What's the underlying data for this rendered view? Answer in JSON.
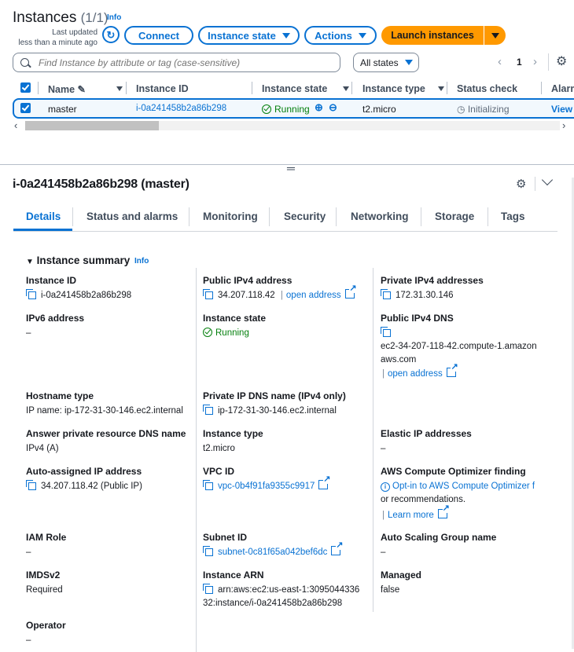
{
  "header": {
    "title": "Instances",
    "count": "(1/1)",
    "info": "Info",
    "last_updated_line1": "Last updated",
    "last_updated_line2": "less than a minute ago",
    "connect": "Connect",
    "instance_state": "Instance state",
    "actions": "Actions",
    "launch": "Launch instances"
  },
  "search": {
    "placeholder": "Find Instance by attribute or tag (case-sensitive)",
    "filter": "All states",
    "page": "1"
  },
  "table": {
    "columns": [
      "Name",
      "Instance ID",
      "Instance state",
      "Instance type",
      "Status check",
      "Alarm"
    ],
    "row": {
      "name": "master",
      "instance_id": "i-0a241458b2a86b298",
      "state": "Running",
      "type": "t2.micro",
      "status": "Initializing",
      "alarm": "View"
    }
  },
  "detail": {
    "title": "i-0a241458b2a86b298 (master)",
    "tabs": [
      "Details",
      "Status and alarms",
      "Monitoring",
      "Security",
      "Networking",
      "Storage",
      "Tags"
    ],
    "summary": "Instance summary",
    "info": "Info"
  },
  "fields": {
    "instance_id": {
      "label": "Instance ID",
      "value": "i-0a241458b2a86b298"
    },
    "public_ipv4": {
      "label": "Public IPv4 address",
      "value": "34.207.118.42",
      "link": "open address"
    },
    "private_ipv4": {
      "label": "Private IPv4 addresses",
      "value": "172.31.30.146"
    },
    "ipv6": {
      "label": "IPv6 address",
      "value": "–"
    },
    "instance_state": {
      "label": "Instance state",
      "value": "Running"
    },
    "public_dns": {
      "label": "Public IPv4 DNS",
      "value1": "ec2-34-207-118-42.compute-1.amazon",
      "value2": "aws.com",
      "link": "open address"
    },
    "hostname_type": {
      "label": "Hostname type",
      "value": "IP name: ip-172-31-30-146.ec2.internal"
    },
    "private_dns": {
      "label": "Private IP DNS name (IPv4 only)",
      "value": "ip-172-31-30-146.ec2.internal"
    },
    "answer_dns": {
      "label": "Answer private resource DNS name",
      "value": "IPv4 (A)"
    },
    "instance_type": {
      "label": "Instance type",
      "value": "t2.micro"
    },
    "elastic_ip": {
      "label": "Elastic IP addresses",
      "value": "–"
    },
    "auto_ip": {
      "label": "Auto-assigned IP address",
      "value": "34.207.118.42 (Public IP)"
    },
    "vpc_id": {
      "label": "VPC ID",
      "value": "vpc-0b4f91fa9355c9917"
    },
    "optimizer": {
      "label": "AWS Compute Optimizer finding",
      "value1": "Opt-in to AWS Compute Optimizer f",
      "value2": "or recommendations.",
      "link": "Learn more"
    },
    "iam_role": {
      "label": "IAM Role",
      "value": "–"
    },
    "subnet_id": {
      "label": "Subnet ID",
      "value": "subnet-0c81f65a042bef6dc"
    },
    "asg_name": {
      "label": "Auto Scaling Group name",
      "value": "–"
    },
    "imdsv2": {
      "label": "IMDSv2",
      "value": "Required"
    },
    "instance_arn": {
      "label": "Instance ARN",
      "value1": "arn:aws:ec2:us-east-1:3095044336",
      "value2": "32:instance/i-0a241458b2a86b298"
    },
    "managed": {
      "label": "Managed",
      "value": "false"
    },
    "operator": {
      "label": "Operator",
      "value": "–"
    }
  },
  "colors": {
    "accent": "#0972d3",
    "launch": "#ff9900",
    "running": "#037f0c"
  }
}
